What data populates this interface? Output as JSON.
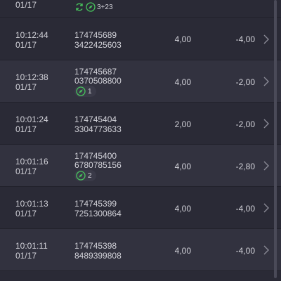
{
  "colors": {
    "background": "#2a2a36",
    "row_alt": "#32323f",
    "text": "#d2d2d9",
    "accent_green": "#47c25c"
  },
  "rows": [
    {
      "time": "",
      "date": "01/17",
      "id1": "",
      "id2": "",
      "amount": "",
      "profit": "",
      "badge": "3+23",
      "badge_icons": [
        "refresh-icon",
        "compass-icon"
      ]
    },
    {
      "time": "10:12:44",
      "date": "01/17",
      "id1": "174745689",
      "id2": "3422425603",
      "amount": "4,00",
      "profit": "-4,00"
    },
    {
      "time": "10:12:38",
      "date": "01/17",
      "id1": "174745687",
      "id2": "0370508800",
      "amount": "4,00",
      "profit": "-2,00",
      "badge": "1",
      "badge_icons": [
        "compass-icon"
      ]
    },
    {
      "time": "10:01:24",
      "date": "01/17",
      "id1": "174745404",
      "id2": "3304773633",
      "amount": "2,00",
      "profit": "-2,00"
    },
    {
      "time": "10:01:16",
      "date": "01/17",
      "id1": "174745400",
      "id2": "6780785156",
      "amount": "4,00",
      "profit": "-2,80",
      "badge": "2",
      "badge_icons": [
        "compass-icon"
      ]
    },
    {
      "time": "10:01:13",
      "date": "01/17",
      "id1": "174745399",
      "id2": "7251300864",
      "amount": "4,00",
      "profit": "-4,00"
    },
    {
      "time": "10:01:11",
      "date": "01/17",
      "id1": "174745398",
      "id2": "8489399808",
      "amount": "4,00",
      "profit": "-4,00"
    }
  ]
}
